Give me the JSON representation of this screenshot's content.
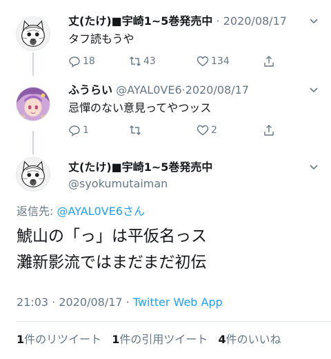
{
  "tweet1": {
    "name": "丈(たけ)■宇崎1~5巻発売中",
    "separator": "·",
    "date": "2020/08/17",
    "text": "タフ読もうや",
    "replies": "18",
    "retweets": "43",
    "likes": "134"
  },
  "tweet2": {
    "name": "ふうらい",
    "handle": "@AYAL0VE6",
    "separator": "·",
    "date": "2020/08/17",
    "text": "忌憚のない意見ってやつッス",
    "replies": "1",
    "retweets": "",
    "likes": "2"
  },
  "focused": {
    "name": "丈(たけ)■宇崎1~5巻発売中",
    "handle": "@syokumutaiman",
    "reply_prefix": "返信先: ",
    "reply_mention": "@AYAL0VE6さん",
    "text_line1": "鯱山の「っ」は平仮名っス",
    "text_line2": "灘新影流ではまだまだ初伝",
    "time": "21:03 · 2020/08/17 · ",
    "via": "Twitter Web App",
    "retweet_count": "1",
    "retweet_label": "件のリツイート",
    "quote_count": "1",
    "quote_label": "件の引用ツイート",
    "like_count": "4",
    "like_label": "件のいいね"
  },
  "colors": {
    "link": "#1da1f2",
    "secondary": "#657786",
    "primary": "#14171a"
  }
}
